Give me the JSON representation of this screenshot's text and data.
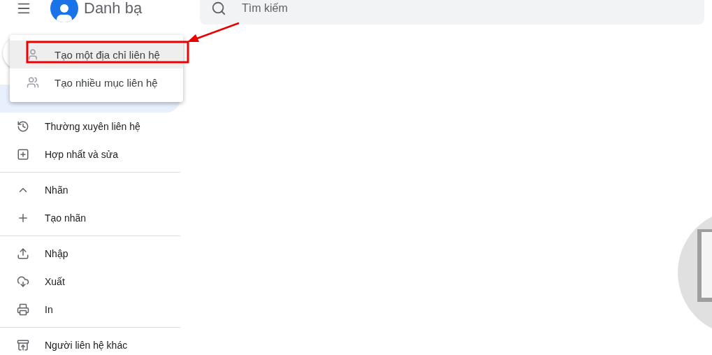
{
  "header": {
    "title": "Danh bạ",
    "search": {
      "placeholder": "Tìm kiếm"
    }
  },
  "create_menu": {
    "items": [
      {
        "label": "Tạo một địa chỉ liên hệ",
        "kind": "single",
        "selected": true
      },
      {
        "label": "Tạo nhiều mục liên hệ",
        "kind": "multiple",
        "selected": false
      }
    ]
  },
  "sidebar": {
    "sections": [
      {
        "items": [
          {
            "label": "Thường xuyên liên hệ",
            "kind": "history"
          },
          {
            "label": "Hợp nhất và sửa",
            "kind": "merge"
          }
        ]
      },
      {
        "items": [
          {
            "label": "Nhãn",
            "kind": "expander",
            "expanded": true
          },
          {
            "label": "Tạo nhãn",
            "kind": "add"
          }
        ]
      },
      {
        "items": [
          {
            "label": "Nhập",
            "kind": "import"
          },
          {
            "label": "Xuất",
            "kind": "export"
          },
          {
            "label": "In",
            "kind": "print"
          }
        ]
      },
      {
        "items": [
          {
            "label": "Người liên hệ khác",
            "kind": "other"
          }
        ]
      }
    ]
  }
}
